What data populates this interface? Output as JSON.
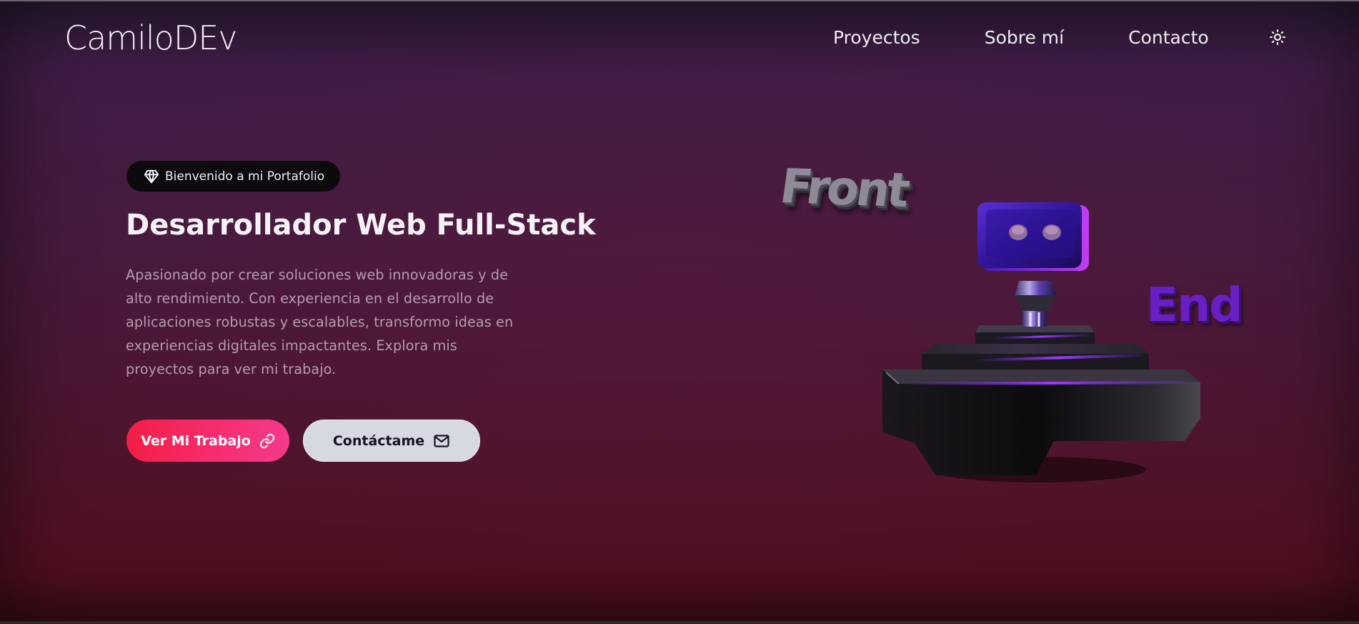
{
  "header": {
    "logo": "CamiloDEv",
    "nav": [
      {
        "label": "Proyectos"
      },
      {
        "label": "Sobre mí"
      },
      {
        "label": "Contacto"
      }
    ],
    "theme_toggle_icon": "sun-icon"
  },
  "hero": {
    "badge": {
      "icon": "gem-icon",
      "label": "Bienvenido a mi Portafolio"
    },
    "title": "Desarrollador Web Full-Stack",
    "description": "Apasionado por crear soluciones web innovadoras y de alto rendimiento. Con experiencia en el desarrollo de aplicaciones robustas y escalables, transformo ideas en experiencias digitales impactantes. Explora mis proyectos para ver mi trabajo.",
    "primary_button": {
      "label": "Ver Mi Trabajo",
      "icon": "link-icon"
    },
    "secondary_button": {
      "label": "Contáctame",
      "icon": "mail-icon"
    }
  },
  "scene": {
    "front_label": "Front",
    "end_label": "End",
    "object_icon": "robot-joystick-3d"
  },
  "colors": {
    "background_top": "#2b1a35",
    "background_bottom": "#520f1f",
    "primary_gradient_start": "#f21e45",
    "primary_gradient_end": "#f33a8c",
    "secondary_button_bg": "#d6d9e2",
    "badge_bg": "#0c0a0d",
    "description_text": "#b49cb2",
    "end_text": "#6a1fc4",
    "front_text": "#8f8a97"
  }
}
